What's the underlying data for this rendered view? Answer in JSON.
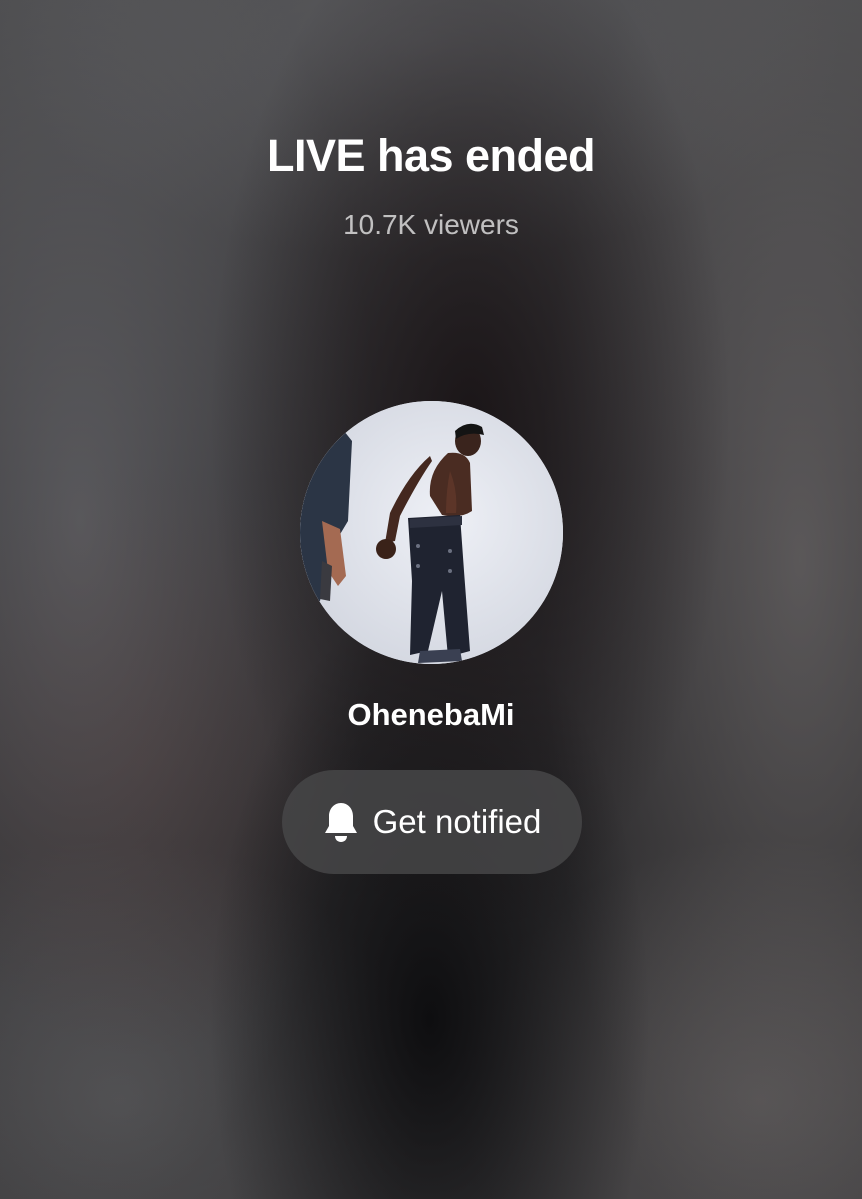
{
  "live_ended": {
    "title": "LIVE has ended",
    "viewers_text": "10.7K viewers"
  },
  "host": {
    "username": "OhenebaMi",
    "avatar_description_icon": "profile-photo"
  },
  "notify_button": {
    "label": "Get notified",
    "icon": "bell-icon"
  },
  "colors": {
    "text_primary": "#ffffff",
    "text_secondary": "#d6d6d6",
    "button_bg": "#464648"
  }
}
